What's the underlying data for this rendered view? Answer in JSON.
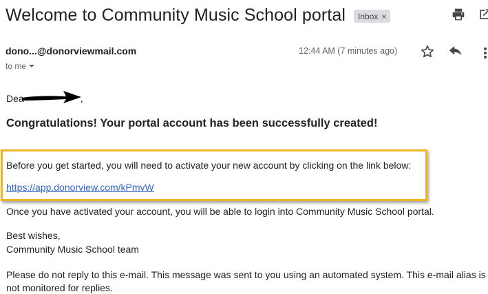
{
  "email": {
    "subject": "Welcome to Community Music School portal",
    "label": "Inbox",
    "label_close": "×",
    "sender": "dono...@donorviewmail.com",
    "recipient": "to me",
    "time": "12:44 AM (7 minutes ago)"
  },
  "body": {
    "greeting_visible": "Dea",
    "greeting_suffix": ",",
    "congrats": "Congratulations! Your portal account has been successfully created!",
    "instruction": "Before you get started, you will need to activate your new account by clicking on the link below:",
    "link": "https://app.donorview.com/kPmvW",
    "after": "Once you have activated your account, you will be able to login into Community Music School portal.",
    "signoff_line1": "Best wishes,",
    "signoff_line2": "Community Music School team",
    "disclaimer": "Please do not reply to this e-mail. This message was sent to you using an automated system. This e-mail alias is not monitored for replies."
  },
  "icons": {
    "print": "print-icon",
    "popout": "open-in-new-window-icon",
    "star": "star-outline-icon",
    "reply": "reply-icon",
    "more": "more-vertical-icon",
    "dropdown": "dropdown-arrow-icon"
  },
  "colors": {
    "highlight_border": "#f0b323",
    "link": "#3366cc",
    "chip_bg": "#dadce0"
  }
}
